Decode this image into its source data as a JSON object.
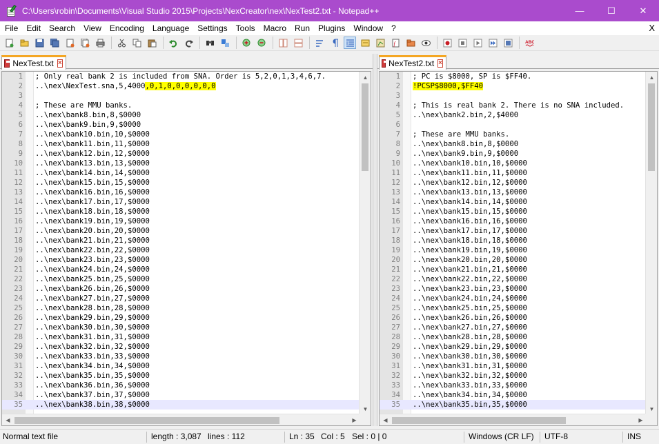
{
  "window": {
    "title": "C:\\Users\\robin\\Documents\\Visual Studio 2015\\Projects\\NexCreator\\nex\\NexTest2.txt - Notepad++",
    "minimize": "—",
    "maximize": "☐",
    "close": "✕"
  },
  "menu": {
    "items": [
      "File",
      "Edit",
      "Search",
      "View",
      "Encoding",
      "Language",
      "Settings",
      "Tools",
      "Macro",
      "Run",
      "Plugins",
      "Window",
      "?"
    ],
    "close": "X"
  },
  "colors": {
    "titlebar": "#aa4bcd",
    "highlight": "#ffff00",
    "current_line": "#e8e8ff",
    "tab_accent": "#f4a623"
  },
  "left": {
    "tab_label": "NexTest.txt",
    "lines": [
      {
        "n": "1",
        "t": "; Only real bank 2 is included from SNA. Order is 5,2,0,1,3,4,6,7."
      },
      {
        "n": "2",
        "t": "..\\nex\\NexTest.sna,5,4000",
        "h": ",0,1,0,0,0,0,0,0"
      },
      {
        "n": "3",
        "t": ""
      },
      {
        "n": "4",
        "t": "; These are MMU banks."
      },
      {
        "n": "5",
        "t": "..\\nex\\bank8.bin,8,$0000"
      },
      {
        "n": "6",
        "t": "..\\nex\\bank9.bin,9,$0000"
      },
      {
        "n": "7",
        "t": "..\\nex\\bank10.bin,10,$0000"
      },
      {
        "n": "8",
        "t": "..\\nex\\bank11.bin,11,$0000"
      },
      {
        "n": "9",
        "t": "..\\nex\\bank12.bin,12,$0000"
      },
      {
        "n": "10",
        "t": "..\\nex\\bank13.bin,13,$0000"
      },
      {
        "n": "11",
        "t": "..\\nex\\bank14.bin,14,$0000"
      },
      {
        "n": "12",
        "t": "..\\nex\\bank15.bin,15,$0000"
      },
      {
        "n": "13",
        "t": "..\\nex\\bank16.bin,16,$0000"
      },
      {
        "n": "14",
        "t": "..\\nex\\bank17.bin,17,$0000"
      },
      {
        "n": "15",
        "t": "..\\nex\\bank18.bin,18,$0000"
      },
      {
        "n": "16",
        "t": "..\\nex\\bank19.bin,19,$0000"
      },
      {
        "n": "17",
        "t": "..\\nex\\bank20.bin,20,$0000"
      },
      {
        "n": "18",
        "t": "..\\nex\\bank21.bin,21,$0000"
      },
      {
        "n": "19",
        "t": "..\\nex\\bank22.bin,22,$0000"
      },
      {
        "n": "20",
        "t": "..\\nex\\bank23.bin,23,$0000"
      },
      {
        "n": "21",
        "t": "..\\nex\\bank24.bin,24,$0000"
      },
      {
        "n": "22",
        "t": "..\\nex\\bank25.bin,25,$0000"
      },
      {
        "n": "23",
        "t": "..\\nex\\bank26.bin,26,$0000"
      },
      {
        "n": "24",
        "t": "..\\nex\\bank27.bin,27,$0000"
      },
      {
        "n": "25",
        "t": "..\\nex\\bank28.bin,28,$0000"
      },
      {
        "n": "26",
        "t": "..\\nex\\bank29.bin,29,$0000"
      },
      {
        "n": "27",
        "t": "..\\nex\\bank30.bin,30,$0000"
      },
      {
        "n": "28",
        "t": "..\\nex\\bank31.bin,31,$0000"
      },
      {
        "n": "29",
        "t": "..\\nex\\bank32.bin,32,$0000"
      },
      {
        "n": "30",
        "t": "..\\nex\\bank33.bin,33,$0000"
      },
      {
        "n": "31",
        "t": "..\\nex\\bank34.bin,34,$0000"
      },
      {
        "n": "32",
        "t": "..\\nex\\bank35.bin,35,$0000"
      },
      {
        "n": "33",
        "t": "..\\nex\\bank36.bin,36,$0000"
      },
      {
        "n": "34",
        "t": "..\\nex\\bank37.bin,37,$0000"
      },
      {
        "n": "35",
        "t": "..\\nex\\bank38.bin,38,$0000",
        "current": true
      }
    ]
  },
  "right": {
    "tab_label": "NexTest2.txt",
    "lines": [
      {
        "n": "1",
        "t": "; PC is $8000, SP is $FF40."
      },
      {
        "n": "2",
        "t": "",
        "h": "!PCSP$8000,$FF40"
      },
      {
        "n": "3",
        "t": ""
      },
      {
        "n": "4",
        "t": "; This is real bank 2. There is no SNA included."
      },
      {
        "n": "5",
        "t": "..\\nex\\bank2.bin,2,$4000"
      },
      {
        "n": "6",
        "t": ""
      },
      {
        "n": "7",
        "t": "; These are MMU banks."
      },
      {
        "n": "8",
        "t": "..\\nex\\bank8.bin,8,$0000"
      },
      {
        "n": "9",
        "t": "..\\nex\\bank9.bin,9,$0000"
      },
      {
        "n": "10",
        "t": "..\\nex\\bank10.bin,10,$0000"
      },
      {
        "n": "11",
        "t": "..\\nex\\bank11.bin,11,$0000"
      },
      {
        "n": "12",
        "t": "..\\nex\\bank12.bin,12,$0000"
      },
      {
        "n": "13",
        "t": "..\\nex\\bank13.bin,13,$0000"
      },
      {
        "n": "14",
        "t": "..\\nex\\bank14.bin,14,$0000"
      },
      {
        "n": "15",
        "t": "..\\nex\\bank15.bin,15,$0000"
      },
      {
        "n": "16",
        "t": "..\\nex\\bank16.bin,16,$0000"
      },
      {
        "n": "17",
        "t": "..\\nex\\bank17.bin,17,$0000"
      },
      {
        "n": "18",
        "t": "..\\nex\\bank18.bin,18,$0000"
      },
      {
        "n": "19",
        "t": "..\\nex\\bank19.bin,19,$0000"
      },
      {
        "n": "20",
        "t": "..\\nex\\bank20.bin,20,$0000"
      },
      {
        "n": "21",
        "t": "..\\nex\\bank21.bin,21,$0000"
      },
      {
        "n": "22",
        "t": "..\\nex\\bank22.bin,22,$0000"
      },
      {
        "n": "23",
        "t": "..\\nex\\bank23.bin,23,$0000"
      },
      {
        "n": "24",
        "t": "..\\nex\\bank24.bin,24,$0000"
      },
      {
        "n": "25",
        "t": "..\\nex\\bank25.bin,25,$0000"
      },
      {
        "n": "26",
        "t": "..\\nex\\bank26.bin,26,$0000"
      },
      {
        "n": "27",
        "t": "..\\nex\\bank27.bin,27,$0000"
      },
      {
        "n": "28",
        "t": "..\\nex\\bank28.bin,28,$0000"
      },
      {
        "n": "29",
        "t": "..\\nex\\bank29.bin,29,$0000"
      },
      {
        "n": "30",
        "t": "..\\nex\\bank30.bin,30,$0000"
      },
      {
        "n": "31",
        "t": "..\\nex\\bank31.bin,31,$0000"
      },
      {
        "n": "32",
        "t": "..\\nex\\bank32.bin,32,$0000"
      },
      {
        "n": "33",
        "t": "..\\nex\\bank33.bin,33,$0000"
      },
      {
        "n": "34",
        "t": "..\\nex\\bank34.bin,34,$0000"
      },
      {
        "n": "35",
        "t": "..\\nex\\bank35.bin,35,$0000",
        "current": true
      }
    ]
  },
  "status": {
    "file_type": "Normal text file",
    "length": "length : 3,087",
    "lines": "lines : 112",
    "ln": "Ln : 35",
    "col": "Col : 5",
    "sel": "Sel : 0 | 0",
    "eol": "Windows (CR LF)",
    "encoding": "UTF-8",
    "mode": "INS"
  },
  "toolbar": {
    "icons": [
      "new-file-icon",
      "open-file-icon",
      "save-icon",
      "save-all-icon",
      "close-icon",
      "close-all-icon",
      "print-icon",
      "cut-icon",
      "copy-icon",
      "paste-icon",
      "undo-icon",
      "redo-icon",
      "find-icon",
      "replace-icon",
      "zoom-in-icon",
      "zoom-out-icon",
      "sync-vertical-icon",
      "sync-horizontal-icon",
      "word-wrap-icon",
      "show-all-chars-icon",
      "indent-guide-icon",
      "user-defined-lang-icon",
      "doc-map-icon",
      "function-list-icon",
      "folder-workspace-icon",
      "monitoring-icon",
      "record-macro-icon",
      "stop-record-icon",
      "play-macro-icon",
      "play-multiple-icon",
      "save-macro-icon",
      "spell-check-icon"
    ]
  }
}
